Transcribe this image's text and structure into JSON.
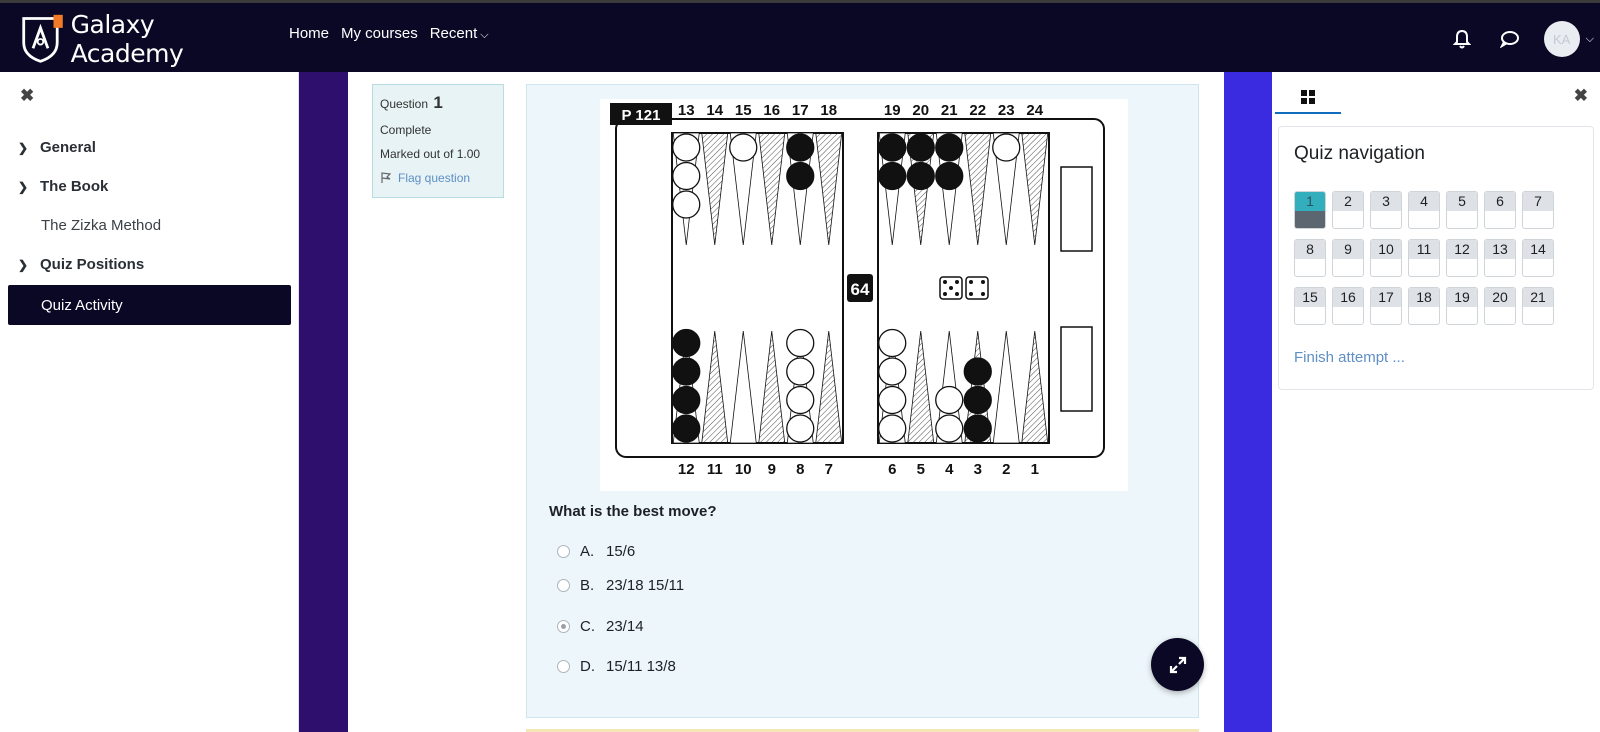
{
  "navbar": {
    "brand": "Galaxy Academy",
    "links": [
      "Home",
      "My courses",
      "Recent"
    ],
    "avatar_initials": "KA"
  },
  "course_index": {
    "items": [
      {
        "label": "General",
        "type": "section"
      },
      {
        "label": "The Book",
        "type": "section"
      },
      {
        "label": "The Zizka Method",
        "type": "activity"
      },
      {
        "label": "Quiz Positions",
        "type": "section"
      },
      {
        "label": "Quiz Activity",
        "type": "active"
      }
    ]
  },
  "question_info": {
    "label": "Question",
    "number": "1",
    "state": "Complete",
    "grade": "Marked out of 1.00",
    "flag_label": "Flag question"
  },
  "board": {
    "position_label": "P 121",
    "cube_value": "64",
    "top_points": [
      "13",
      "14",
      "15",
      "16",
      "17",
      "18",
      "19",
      "20",
      "21",
      "22",
      "23",
      "24"
    ],
    "bottom_points": [
      "12",
      "11",
      "10",
      "9",
      "8",
      "7",
      "6",
      "5",
      "4",
      "3",
      "2",
      "1"
    ],
    "dice": [
      5,
      4
    ],
    "checkers": {
      "13": {
        "color": "white",
        "count": 3
      },
      "15": {
        "color": "white",
        "count": 1
      },
      "17": {
        "color": "black",
        "count": 2
      },
      "19": {
        "color": "black",
        "count": 2
      },
      "20": {
        "color": "black",
        "count": 2
      },
      "21": {
        "color": "black",
        "count": 2
      },
      "23": {
        "color": "white",
        "count": 1
      },
      "12": {
        "color": "black",
        "count": 4
      },
      "8": {
        "color": "white",
        "count": 4
      },
      "6": {
        "color": "white",
        "count": 4
      },
      "4": {
        "color": "white",
        "count": 2
      },
      "3": {
        "color": "black",
        "count": 3
      }
    }
  },
  "question": {
    "text": "What is the best move?",
    "answers": [
      {
        "letter": "A.",
        "text": "15/6",
        "checked": false
      },
      {
        "letter": "B.",
        "text": "23/18 15/11",
        "checked": false
      },
      {
        "letter": "C.",
        "text": "23/14",
        "checked": true
      },
      {
        "letter": "D.",
        "text": "15/11 13/8",
        "checked": false
      }
    ]
  },
  "quiz_navigation": {
    "title": "Quiz navigation",
    "questions": [
      "1",
      "2",
      "3",
      "4",
      "5",
      "6",
      "7",
      "8",
      "9",
      "10",
      "11",
      "12",
      "13",
      "14",
      "15",
      "16",
      "17",
      "18",
      "19",
      "20",
      "21"
    ],
    "current": "1",
    "finish_label": "Finish attempt ..."
  },
  "colors": {
    "navbar": "#0b0826",
    "band_left": "#2e0f6e",
    "band_right": "#3a2ae0",
    "current_question": "#33aebd",
    "link": "#5f8fc4"
  }
}
